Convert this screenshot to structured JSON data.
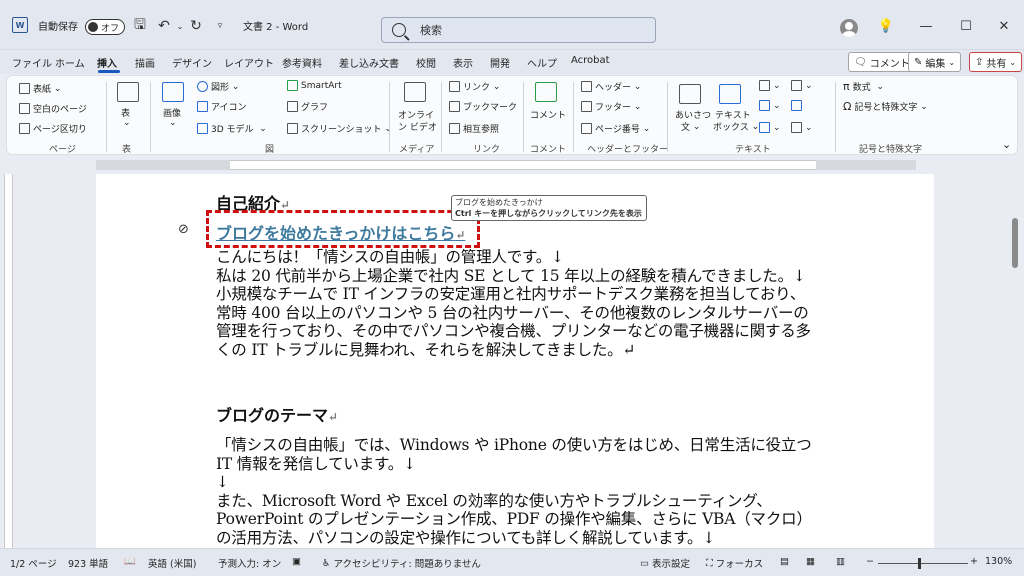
{
  "titlebar": {
    "autosave_label": "自動保存",
    "autosave_state": "オフ",
    "doc_title": "文書 2 - Word",
    "search_placeholder": "検索"
  },
  "tabs": [
    "ファイル",
    "ホーム",
    "挿入",
    "描画",
    "デザイン",
    "レイアウト",
    "参考資料",
    "差し込み文書",
    "校閲",
    "表示",
    "開発",
    "ヘルプ",
    "Acrobat"
  ],
  "active_tab": "挿入",
  "top_buttons": {
    "comment": "コメント",
    "edit": "編集",
    "share": "共有"
  },
  "ribbon": {
    "pages": {
      "label": "ページ",
      "cover": "表紙",
      "blank": "空白のページ",
      "break": "ページ区切り"
    },
    "table": {
      "label": "表",
      "btn": "表"
    },
    "illustrations": {
      "label": "図",
      "image": "画像",
      "shapes": "図形",
      "icons": "アイコン",
      "model3d": "3D モデル",
      "smartart": "SmartArt",
      "chart": "グラフ",
      "screenshot": "スクリーンショット"
    },
    "media": {
      "label": "メディア",
      "online_video_1": "オンライ",
      "online_video_2": "ン ビデオ"
    },
    "links": {
      "label": "リンク",
      "link": "リンク",
      "bookmark": "ブックマーク",
      "crossref": "相互参照"
    },
    "comments": {
      "label": "コメント",
      "comment": "コメント"
    },
    "headerfooter": {
      "label": "ヘッダーとフッター",
      "header": "ヘッダー",
      "footer": "フッター",
      "pagenum": "ページ番号"
    },
    "text": {
      "label": "テキスト",
      "greeting_1": "あいさつ",
      "greeting_2": "文",
      "textbox_1": "テキスト",
      "textbox_2": "ボックス"
    },
    "symbols": {
      "label": "記号と特殊文字",
      "equation": "数式",
      "symbol": "記号と特殊文字"
    }
  },
  "document": {
    "heading_intro": "自己紹介",
    "link_text": "ブログを始めたきっかけはこちら",
    "tooltip_line1": "ブログを始めたきっかけ",
    "tooltip_line2": "Ctrl キーを押しながらクリックしてリンク先を表示",
    "intro_paragraphs": [
      "こんにちは！「情シスの自由帳」の管理人です。↓",
      "私は 20 代前半から上場企業で社内 SE として 15 年以上の経験を積んできました。↓",
      "小規模なチームで IT インフラの安定運用と社内サポートデスク業務を担当しており、常時 400 台以上のパソコンや 5 台の社内サーバー、その他複数のレンタルサーバーの管理を行っており、その中でパソコンや複合機、プリンターなどの電子機器に関する多くの IT トラブルに見舞われ、それらを解決してきました。↵"
    ],
    "heading_theme": "ブログのテーマ",
    "theme_paragraphs": [
      "「情シスの自由帳」では、Windows や iPhone の使い方をはじめ、日常生活に役立つ IT 情報を発信しています。↓",
      "↓",
      "また、Microsoft Word や Excel の効率的な使い方やトラブルシューティング、PowerPoint のプレゼンテーション作成、PDF の操作や編集、さらに VBA（マクロ）の活用方法、パソコンの設定や操作についても詳しく解説しています。↓"
    ]
  },
  "statusbar": {
    "page": "1/2 ページ",
    "words": "923 単語",
    "language": "英語 (米国)",
    "predict": "予測入力: オン",
    "accessibility": "アクセシビリティ: 問題ありません",
    "display_settings": "表示設定",
    "focus": "フォーカス",
    "zoom": "130%"
  }
}
